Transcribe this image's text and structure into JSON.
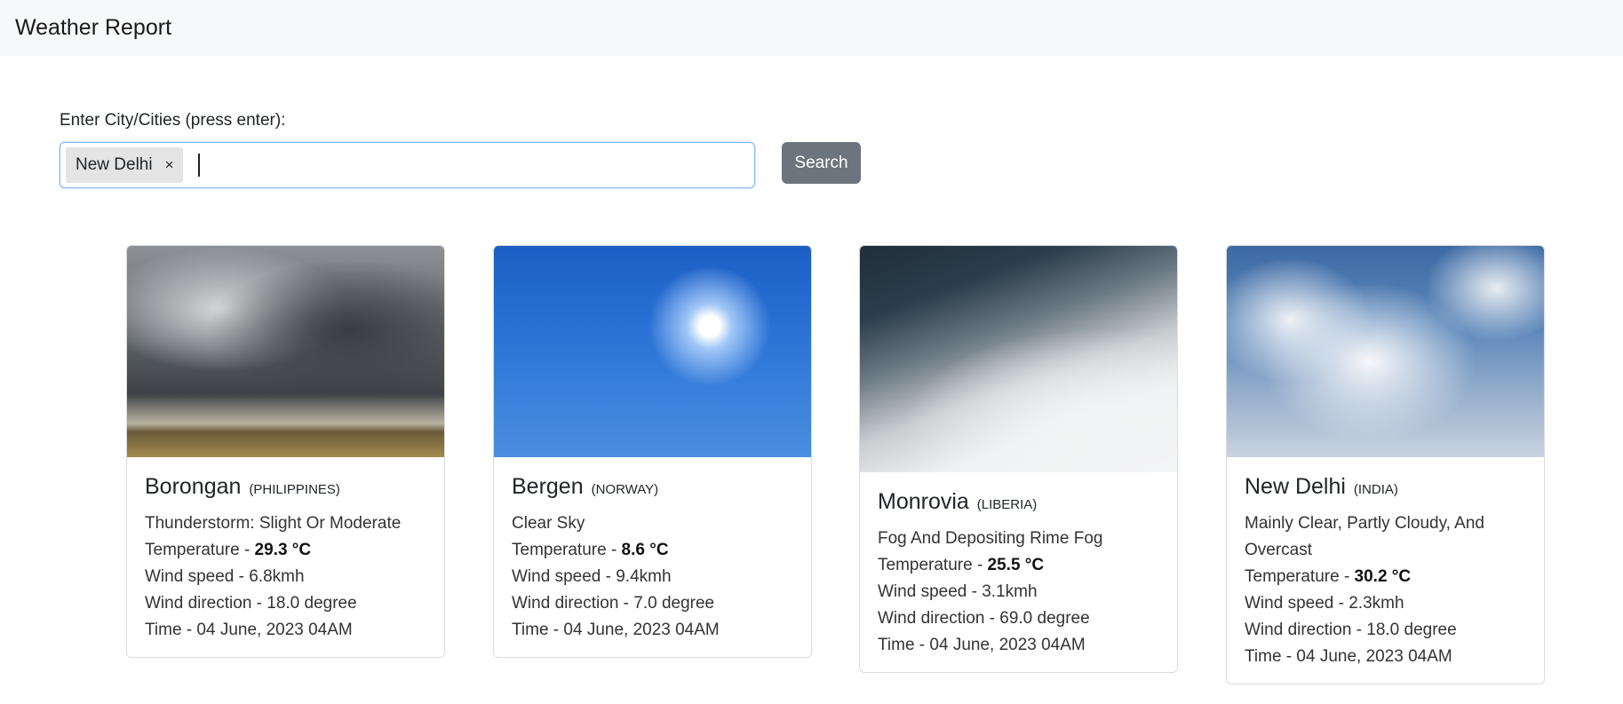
{
  "navbar": {
    "brand": "Weather Report"
  },
  "search": {
    "label": "Enter City/Cities (press enter):",
    "tags": [
      "New Delhi"
    ],
    "tag_close": "×",
    "button_label": "Search"
  },
  "cards": [
    {
      "city": "Borongan",
      "country": "(PHILIPPINES)",
      "condition": "Thunderstorm: Slight Or Moderate",
      "temp_prefix": "Temperature - ",
      "temp_value": "29.3 °C",
      "wind_speed": "Wind speed - 6.8kmh",
      "wind_direction": "Wind direction - 18.0 degree",
      "time": "Time - 04 June, 2023 04AM",
      "image_icon": "storm-image"
    },
    {
      "city": "Bergen",
      "country": "(NORWAY)",
      "condition": "Clear Sky",
      "temp_prefix": "Temperature - ",
      "temp_value": "8.6 °C",
      "wind_speed": "Wind speed - 9.4kmh",
      "wind_direction": "Wind direction - 7.0 degree",
      "time": "Time - 04 June, 2023 04AM",
      "image_icon": "clear-sky-image"
    },
    {
      "city": "Monrovia",
      "country": "(LIBERIA)",
      "condition": "Fog And Depositing Rime Fog",
      "temp_prefix": "Temperature - ",
      "temp_value": "25.5 °C",
      "wind_speed": "Wind speed - 3.1kmh",
      "wind_direction": "Wind direction - 69.0 degree",
      "time": "Time - 04 June, 2023 04AM",
      "image_icon": "fog-image"
    },
    {
      "city": "New Delhi",
      "country": "(INDIA)",
      "condition": "Mainly Clear, Partly Cloudy, And Overcast",
      "temp_prefix": "Temperature - ",
      "temp_value": "30.2 °C",
      "wind_speed": "Wind speed - 2.3kmh",
      "wind_direction": "Wind direction - 18.0 degree",
      "time": "Time - 04 June, 2023 04AM",
      "image_icon": "clouds-image"
    }
  ],
  "colors": {
    "navbar_bg": "#f8f9fa",
    "button_bg": "#6c757d",
    "input_focus_border": "#86b7fe",
    "tag_bg": "#e4e4e4"
  }
}
